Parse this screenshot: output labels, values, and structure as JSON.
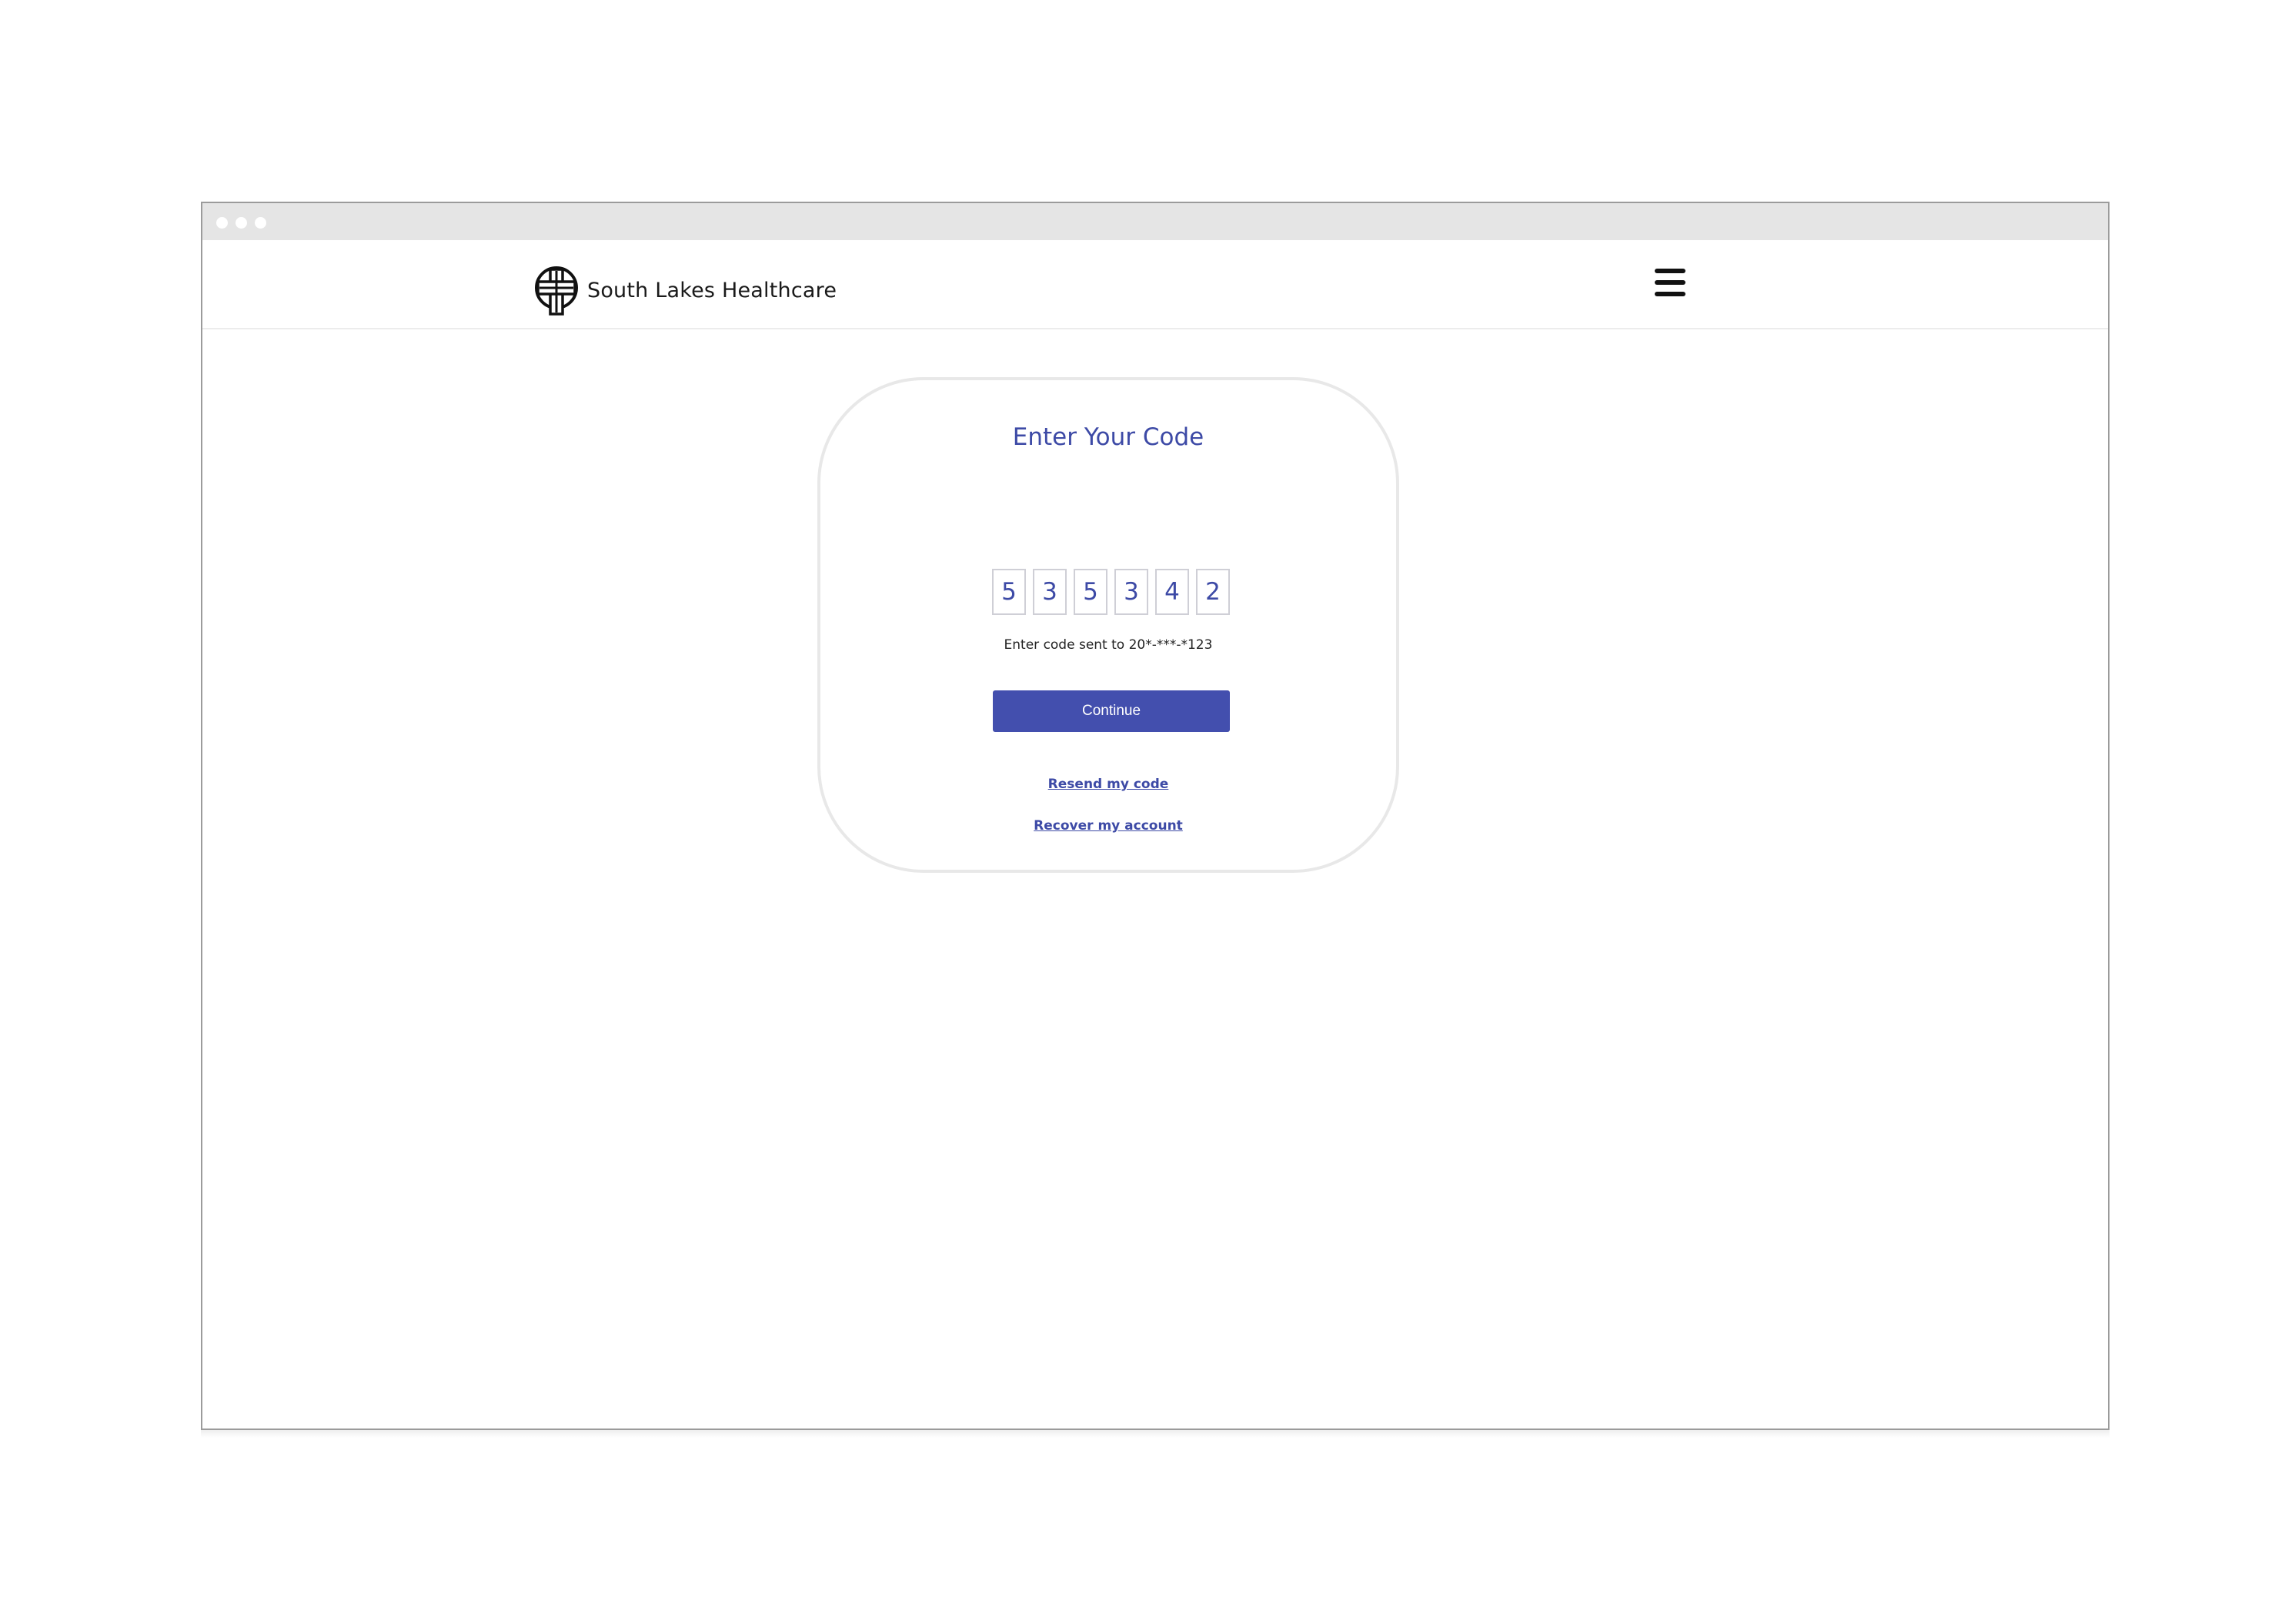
{
  "app": {
    "brand_name": "South Lakes Healthcare",
    "logo_icon": "cross-circle-logo-icon",
    "menu_icon": "hamburger-menu-icon"
  },
  "verification": {
    "title": "Enter Your Code",
    "code_digits": [
      "5",
      "3",
      "5",
      "3",
      "4",
      "2"
    ],
    "hint": "Enter code sent to 20*-***-*123",
    "continue_label": "Continue",
    "resend_label": "Resend my code",
    "recover_label": "Recover my account"
  },
  "colors": {
    "accent": "#3d4aa6",
    "button": "#434fae",
    "titlebar": "#e5e5e5"
  }
}
